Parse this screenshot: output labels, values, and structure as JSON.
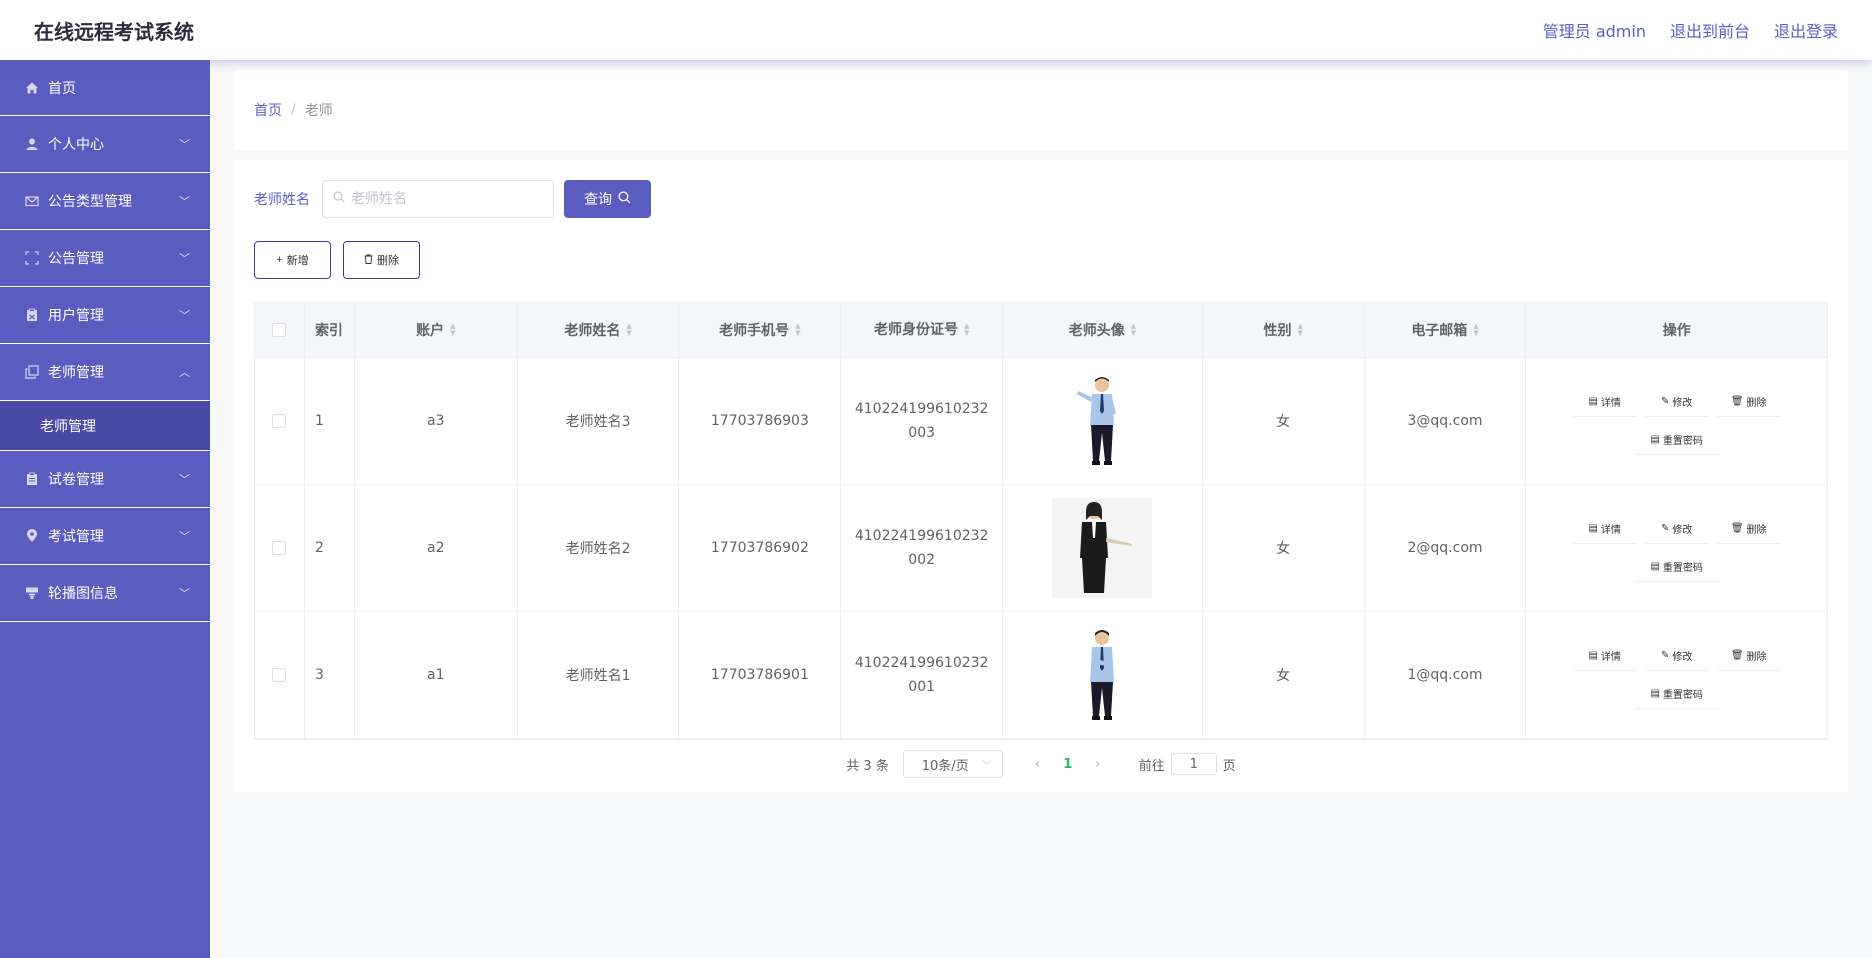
{
  "header": {
    "title": "在线远程考试系统",
    "admin_label": "管理员 admin",
    "front_link": "退出到前台",
    "logout_link": "退出登录"
  },
  "sidebar": {
    "items": [
      {
        "label": "首页",
        "icon": "home-icon"
      },
      {
        "label": "个人中心",
        "icon": "user-icon"
      },
      {
        "label": "公告类型管理",
        "icon": "mail-icon"
      },
      {
        "label": "公告管理",
        "icon": "frame-icon"
      },
      {
        "label": "用户管理",
        "icon": "clipboard-icon"
      },
      {
        "label": "老师管理",
        "icon": "copy-icon"
      },
      {
        "label": "试卷管理",
        "icon": "paper-icon"
      },
      {
        "label": "考试管理",
        "icon": "location-icon"
      },
      {
        "label": "轮播图信息",
        "icon": "carousel-icon"
      }
    ],
    "submenu_label": "老师管理"
  },
  "breadcrumb": {
    "home": "首页",
    "separator": "/",
    "current": "老师"
  },
  "search": {
    "label": "老师姓名",
    "placeholder": "老师姓名",
    "button_label": "查询"
  },
  "actions": {
    "add_label": "新增",
    "delete_label": "删除"
  },
  "table": {
    "headers": [
      "索引",
      "账户",
      "老师姓名",
      "老师手机号",
      "老师身份证号",
      "老师头像",
      "性别",
      "电子邮箱",
      "操作"
    ],
    "rows": [
      {
        "index": "1",
        "account": "a3",
        "name": "老师姓名3",
        "phone": "17703786903",
        "id_card": "410224199610232003",
        "gender": "女",
        "email": "3@qq.com"
      },
      {
        "index": "2",
        "account": "a2",
        "name": "老师姓名2",
        "phone": "17703786902",
        "id_card": "410224199610232002",
        "gender": "女",
        "email": "2@qq.com"
      },
      {
        "index": "3",
        "account": "a1",
        "name": "老师姓名1",
        "phone": "17703786901",
        "id_card": "410224199610232001",
        "gender": "女",
        "email": "1@qq.com"
      }
    ],
    "op_labels": {
      "detail": "详情",
      "edit": "修改",
      "delete": "删除",
      "reset": "重置密码"
    }
  },
  "pagination": {
    "total": "共 3 条",
    "page_size": "10条/页",
    "current_page": "1",
    "goto_prefix": "前往",
    "goto_value": "1",
    "goto_suffix": "页"
  },
  "colors": {
    "sidebar_bg": "#5b5cbf",
    "accent": "#5b5fc7",
    "active_page": "#2bb673"
  }
}
